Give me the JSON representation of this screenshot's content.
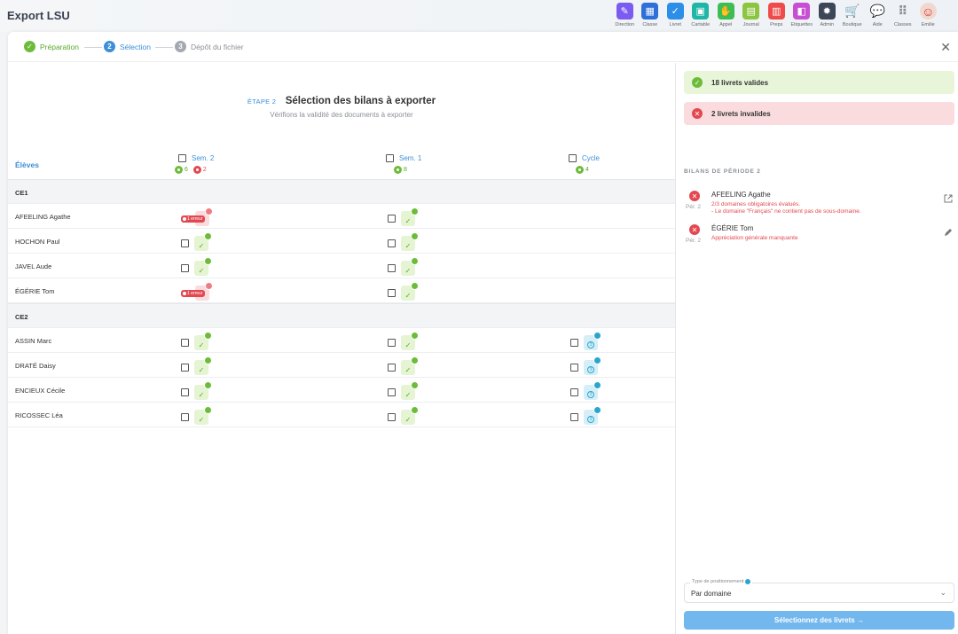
{
  "app": {
    "title": "Export LSU"
  },
  "nav": [
    {
      "label": "Direction",
      "icon": "pencil-icon",
      "color": "#7c5cf0"
    },
    {
      "label": "Classe",
      "icon": "board-icon",
      "color": "#2e6fd9"
    },
    {
      "label": "Livret",
      "icon": "check-icon",
      "color": "#2d8ee8"
    },
    {
      "label": "Cartable",
      "icon": "briefcase-icon",
      "color": "#1fb6a6"
    },
    {
      "label": "Appel",
      "icon": "hand-icon",
      "color": "#3dbe54"
    },
    {
      "label": "Journal",
      "icon": "calendar-icon",
      "color": "#8cc53f"
    },
    {
      "label": "Preps",
      "icon": "document-icon",
      "color": "#ef4b4b"
    },
    {
      "label": "Etiquettes",
      "icon": "label-icon",
      "color": "#c74fd3"
    },
    {
      "label": "Admin",
      "icon": "gear-icon",
      "color": "#3c4656"
    },
    {
      "label": "Boutique",
      "icon": "cart-icon",
      "color": ""
    },
    {
      "label": "Aide",
      "icon": "chat-icon",
      "color": ""
    },
    {
      "label": "Classes",
      "icon": "grid-icon",
      "color": ""
    },
    {
      "label": "Emilie",
      "icon": "avatar-icon",
      "color": ""
    }
  ],
  "stepper": {
    "steps": [
      {
        "num": "",
        "label": "Préparation",
        "state": "done"
      },
      {
        "num": "2",
        "label": "Sélection",
        "state": "active"
      },
      {
        "num": "3",
        "label": "Dépôt du fichier",
        "state": "todo"
      }
    ]
  },
  "main": {
    "step_tag": "ÉTAPE 2",
    "title": "Sélection des bilans à exporter",
    "subtitle": "Vérifions la validité des documents à exporter",
    "students_header": "Élèves",
    "columns": [
      {
        "label": "Sem. 2",
        "ok_count": "6",
        "err_count": "2"
      },
      {
        "label": "Sem. 1",
        "ok_count": "8",
        "err_count": ""
      },
      {
        "label": "Cycle",
        "ok_count": "4",
        "err_count": ""
      }
    ],
    "error_badge": "1 erreur",
    "cycle_num": "3",
    "rows": [
      {
        "type": "group",
        "name": "CE1"
      },
      {
        "type": "student",
        "name": "AFEELING Agathe",
        "sem2": "error",
        "sem1": "ok",
        "cycle": ""
      },
      {
        "type": "student",
        "name": "HOCHON Paul",
        "sem2": "ok",
        "sem1": "ok",
        "cycle": ""
      },
      {
        "type": "student",
        "name": "JAVEL Aude",
        "sem2": "ok",
        "sem1": "ok",
        "cycle": ""
      },
      {
        "type": "student",
        "name": "ÉGÉRIE Tom",
        "sem2": "error",
        "sem1": "ok",
        "cycle": ""
      },
      {
        "type": "group",
        "name": "CE2"
      },
      {
        "type": "student",
        "name": "ASSIN Marc",
        "sem2": "ok",
        "sem1": "ok",
        "cycle": "ok"
      },
      {
        "type": "student",
        "name": "DRATÉ Daisy",
        "sem2": "ok",
        "sem1": "ok",
        "cycle": "ok"
      },
      {
        "type": "student",
        "name": "ENCIEUX Cécile",
        "sem2": "ok",
        "sem1": "ok",
        "cycle": "ok"
      },
      {
        "type": "student",
        "name": "RICOSSEC Léa",
        "sem2": "ok",
        "sem1": "ok",
        "cycle": "ok"
      }
    ]
  },
  "sidebar": {
    "valid_label": "18 livrets valides",
    "invalid_label": "2 livrets invalides",
    "section_title": "BILANS DE PÉRIODE 2",
    "invalid_items": [
      {
        "name": "AFEELING Agathe",
        "period": "Pér. 2",
        "messages": [
          "2/3 domaines obligatoires évalués.",
          "- Le domaine \"Français\" ne contient pas de sous-domaine."
        ],
        "action": "open-external-icon"
      },
      {
        "name": "ÉGÉRIE Tom",
        "period": "Pér. 2",
        "messages": [
          "Appréciation générale manquante"
        ],
        "action": "edit-pencil-icon"
      }
    ],
    "positioning_label": "Type de positionnement",
    "positioning_value": "Par domaine",
    "submit_label": "Sélectionnez des livrets →"
  },
  "colors": {
    "accent": "#3d8fd8",
    "valid": "#6cbc3a",
    "invalid": "#e34850",
    "cycle": "#29a6cf",
    "button": "#72b7ee"
  }
}
